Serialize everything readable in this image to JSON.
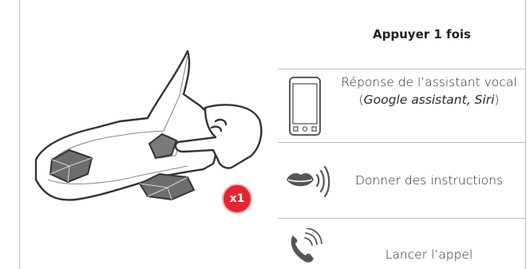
{
  "header": {
    "title": "Appuyer 1 fois"
  },
  "badge": {
    "label": "x1"
  },
  "rows": [
    {
      "icon": "smartphone-icon",
      "label_prefix": "Réponse de l’assistant vocal (",
      "label_emph": "Google assistant, Siri",
      "label_suffix": ")"
    },
    {
      "icon": "speaking-mouth-icon",
      "label": "Donner des instructions"
    },
    {
      "icon": "phone-call-icon",
      "label": "Lancer l’appel"
    }
  ],
  "colors": {
    "accent_badge": "#e2262f",
    "separator": "#bdbdbd",
    "icon": "#5b5b5b"
  }
}
